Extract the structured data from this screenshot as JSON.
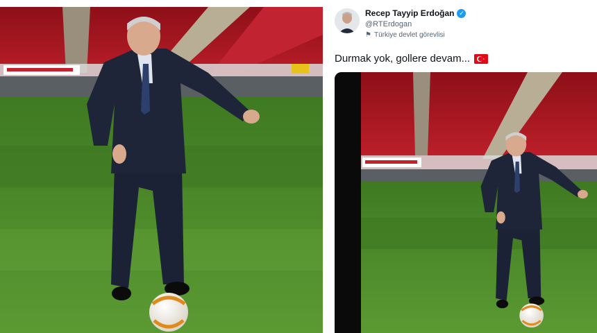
{
  "tweet": {
    "display_name": "Recep Tayyip Erdoğan",
    "handle": "@RTErdogan",
    "account_label": "Türkiye devlet görevlisi",
    "text": "Durmak yok, gollere devam...",
    "verified": true
  },
  "icons": {
    "verified": "verified-badge-icon",
    "label": "government-flag-icon",
    "emoji": "turkey-flag-emoji"
  },
  "colors": {
    "verified_blue": "#1d9bf0",
    "stadium_red": "#c0121f",
    "pitch_green": "#4f8a2a",
    "flag_red": "#e30a17"
  }
}
